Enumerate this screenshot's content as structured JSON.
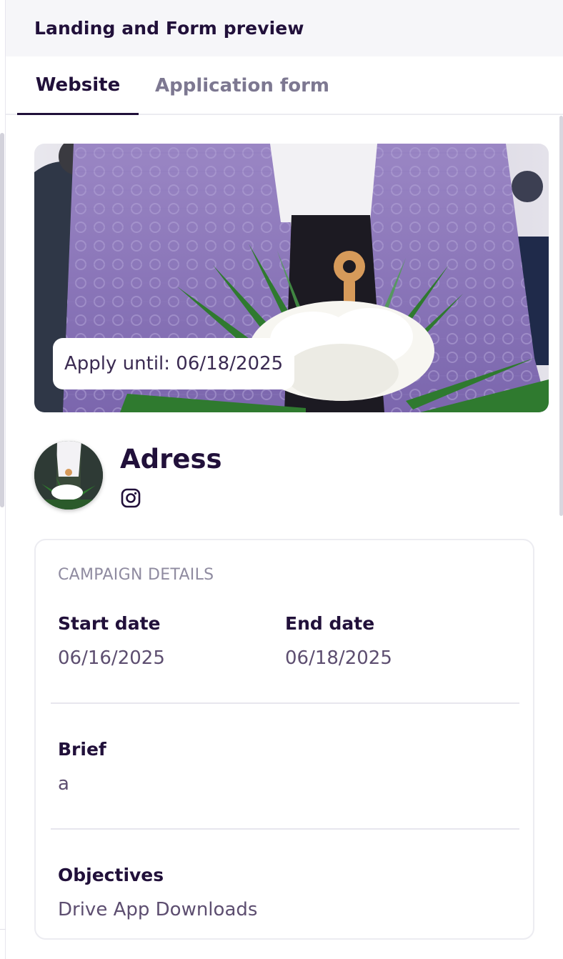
{
  "header": {
    "title": "Landing and Form preview"
  },
  "tabs": [
    {
      "label": "Website",
      "active": true
    },
    {
      "label": "Application form",
      "active": false
    }
  ],
  "hero": {
    "apply_until": "Apply until: 06/18/2025"
  },
  "profile": {
    "name": "Adress",
    "social_icon": "instagram-icon"
  },
  "campaign": {
    "title": "CAMPAIGN DETAILS",
    "start_label": "Start date",
    "start_value": "06/16/2025",
    "end_label": "End date",
    "end_value": "06/18/2025",
    "brief_label": "Brief",
    "brief_value": "a",
    "objectives_label": "Objectives",
    "objectives_value": "Drive App Downloads"
  },
  "colors": {
    "primary_text": "#21103a",
    "muted_text": "#7d7891",
    "value_text": "#5d4e70",
    "header_bg": "#f6f6f9",
    "border": "#ececf1"
  }
}
